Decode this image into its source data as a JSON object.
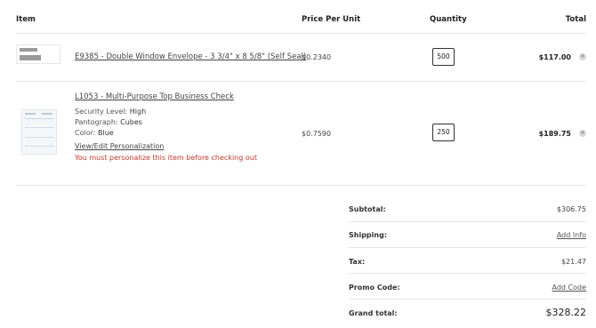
{
  "headers": {
    "item": "Item",
    "price": "Price Per Unit",
    "quantity": "Quantity",
    "total": "Total"
  },
  "items": [
    {
      "name": "E9385 - Double Window Envelope - 3 3/4\" x 8 5/8\" (Self Seal)",
      "price": "$0.2340",
      "quantity": "500",
      "total": "$117.00",
      "remove_icon": "close-icon"
    },
    {
      "name": "L1053 - Multi-Purpose Top Business Check",
      "attributes": [
        {
          "label": "Security Level:",
          "value": "High"
        },
        {
          "label": "Pantograph:",
          "value": "Cubes"
        },
        {
          "label": "Color:",
          "value": "Blue"
        }
      ],
      "personalize_link": "View/Edit Personalization",
      "warning": "You must personalize this item before checking out",
      "price": "$0.7590",
      "quantity": "250",
      "total": "$189.75",
      "remove_icon": "close-icon"
    }
  ],
  "summary": {
    "subtotal_label": "Subtotal:",
    "subtotal_value": "$306.75",
    "shipping_label": "Shipping:",
    "shipping_value": "Add Info",
    "tax_label": "Tax:",
    "tax_value": "$21.47",
    "promo_label": "Promo Code:",
    "promo_value": "Add Code",
    "grand_label": "Grand total:",
    "grand_value": "$328.22"
  },
  "colors": {
    "warning": "#c0392b",
    "divider": "#e6e6e6"
  }
}
